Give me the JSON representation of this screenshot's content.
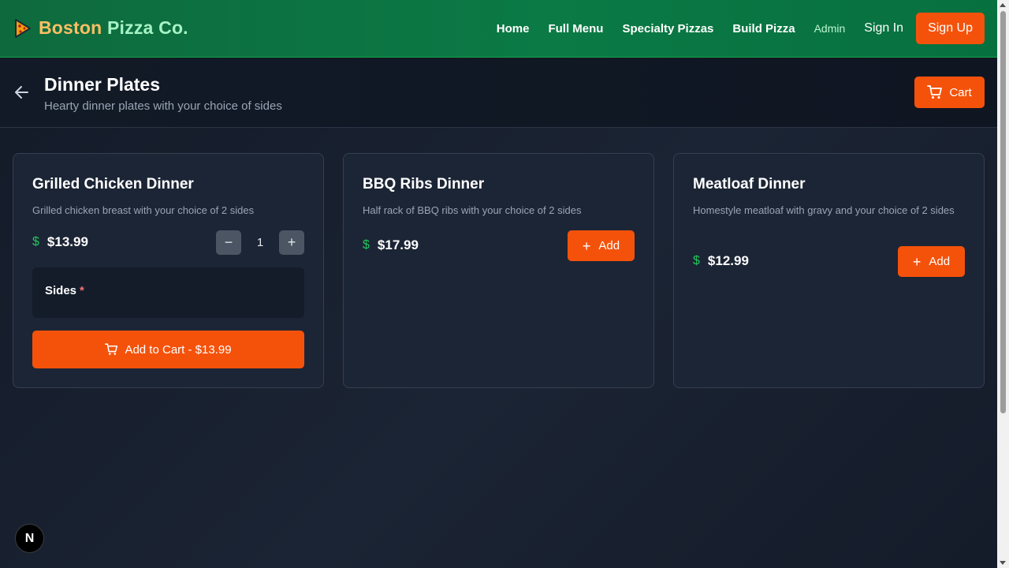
{
  "brand": {
    "name_part1": "Boston",
    "name_part2": "Pizza Co.",
    "icon": "pizza-slice-icon"
  },
  "nav": {
    "home": "Home",
    "full_menu": "Full Menu",
    "specialty_pizzas": "Specialty Pizzas",
    "build_pizza": "Build Pizza",
    "admin": "Admin",
    "sign_in": "Sign In",
    "sign_up": "Sign Up"
  },
  "header": {
    "back_icon": "arrow-left-icon",
    "title": "Dinner Plates",
    "subtitle": "Hearty dinner plates with your choice of sides",
    "cart_label": "Cart",
    "cart_icon": "shopping-cart-icon"
  },
  "items": [
    {
      "name": "Grilled Chicken Dinner",
      "description": "Grilled chicken breast with your choice of 2 sides",
      "currency_symbol": "$",
      "price": "$13.99",
      "quantity": "1",
      "decrement": "−",
      "increment": "+",
      "sides_label": "Sides",
      "required_marker": "*",
      "add_to_cart_label": "Add to Cart - $13.99"
    },
    {
      "name": "BBQ Ribs Dinner",
      "description": "Half rack of BBQ ribs with your choice of 2 sides",
      "currency_symbol": "$",
      "price": "$17.99",
      "add_label": "Add"
    },
    {
      "name": "Meatloaf Dinner",
      "description": "Homestyle meatloaf with gravy and your choice of 2 sides",
      "currency_symbol": "$",
      "price": "$12.99",
      "add_label": "Add"
    }
  ],
  "dev_badge": "N",
  "colors": {
    "accent": "#f4520b",
    "nav_green": "#0b7a45",
    "price_green": "#22c55e",
    "background": "#1b2434"
  }
}
